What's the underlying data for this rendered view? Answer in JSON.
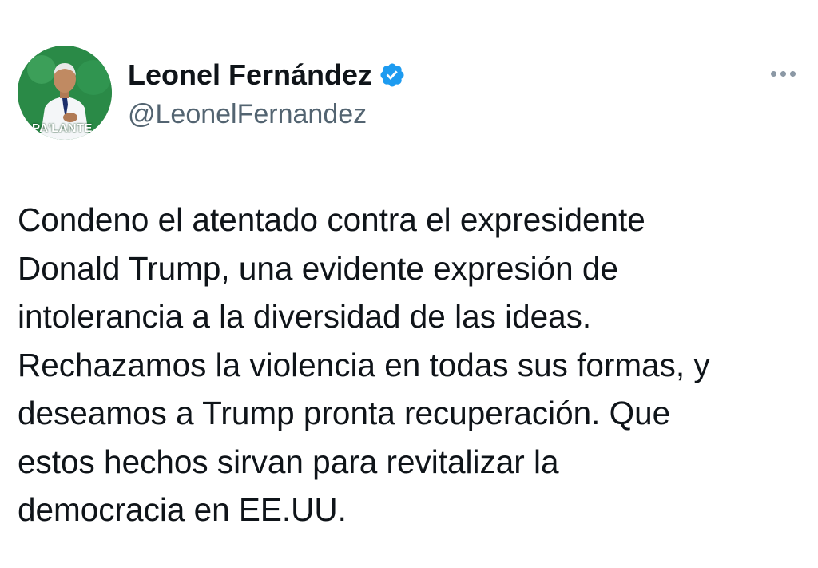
{
  "author": {
    "display_name": "Leonel Fernández",
    "handle": "@LeonelFernandez",
    "avatar_banner_text": "PA'LANTE",
    "verified_icon": "verified-badge-icon"
  },
  "tweet": {
    "text": "Condeno el atentado contra el expresidente\nDonald Trump, una evidente expresión de\nintolerancia a la diversidad de las ideas.\nRechazamos la violencia en todas sus formas, y\ndeseamos a Trump pronta recuperación. Que\nestos hechos sirvan para revitalizar la\ndemocracia en EE.UU."
  },
  "menu": {
    "icon": "more-options-icon"
  },
  "colors": {
    "text_primary": "#0f1419",
    "text_secondary": "#536471",
    "verified_blue": "#1d9bf0",
    "avatar_green": "#1f7a3c",
    "background": "#ffffff"
  }
}
